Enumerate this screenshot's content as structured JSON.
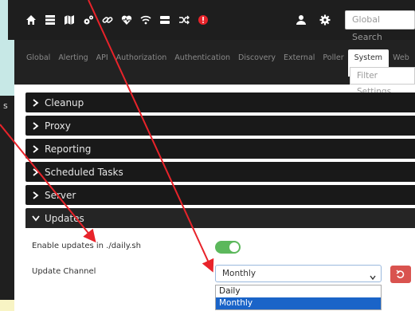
{
  "background": {
    "partial_text": "s"
  },
  "navbar": {
    "icons": [
      "home-icon",
      "server-icon",
      "map-icon",
      "cogs-icon",
      "link-icon",
      "heartbeat-icon",
      "wifi-icon",
      "storage-icon",
      "random-icon",
      "alert-icon"
    ],
    "search_placeholder": "Global Search",
    "accent": "#e8232a"
  },
  "tabs": [
    {
      "label": "Global"
    },
    {
      "label": "Alerting"
    },
    {
      "label": "API"
    },
    {
      "label": "Authorization"
    },
    {
      "label": "Authentication"
    },
    {
      "label": "Discovery"
    },
    {
      "label": "External"
    },
    {
      "label": "Poller"
    },
    {
      "label": "System"
    },
    {
      "label": "Web"
    }
  ],
  "active_tab": "System",
  "filter_placeholder": "Filter Settings",
  "sections": [
    {
      "label": "Cleanup"
    },
    {
      "label": "Proxy"
    },
    {
      "label": "Reporting"
    },
    {
      "label": "Scheduled Tasks"
    },
    {
      "label": "Server"
    },
    {
      "label": "Updates"
    }
  ],
  "updates": {
    "enable_label": "Enable updates in ./daily.sh",
    "enable_value": true,
    "channel_label": "Update Channel",
    "channel_value": "Monthly",
    "options": [
      "Daily",
      "Monthly"
    ],
    "toggle_color": "#5cb85c",
    "reset_color": "#d9534f"
  }
}
